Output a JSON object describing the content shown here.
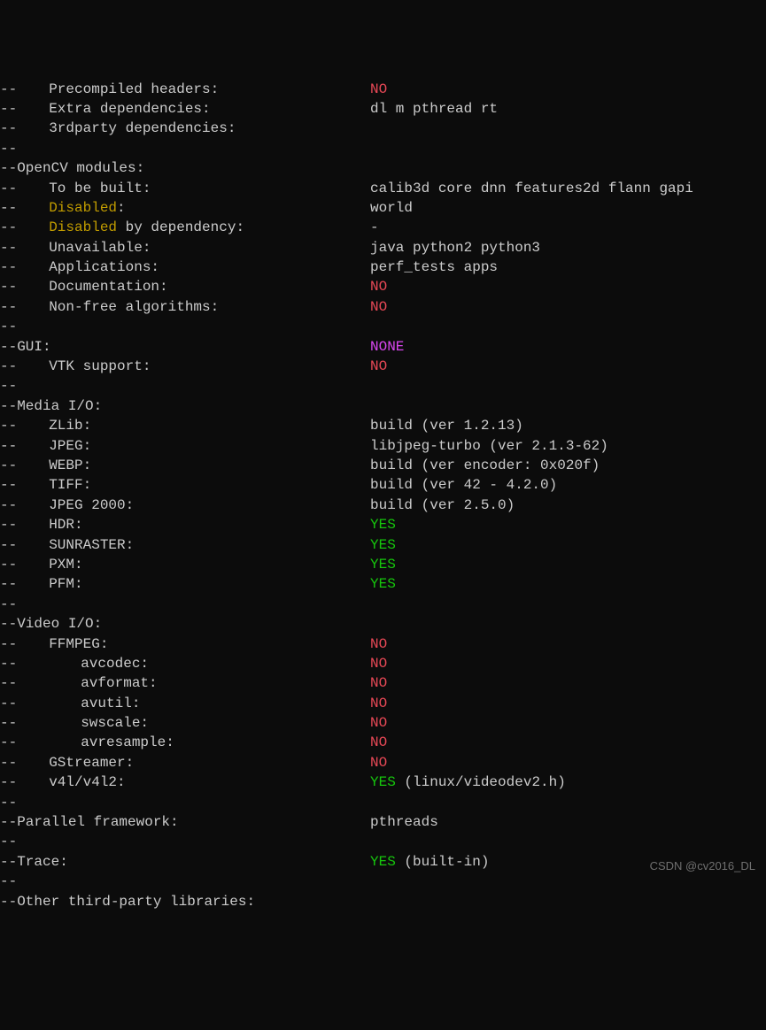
{
  "rows": [
    {
      "dash": "--",
      "indent": 1,
      "label": "Precompiled headers:",
      "value": "NO",
      "vclass": "c-red"
    },
    {
      "dash": "--",
      "indent": 1,
      "label": "Extra dependencies:",
      "value": "dl m pthread rt",
      "vclass": "c-white"
    },
    {
      "dash": "--",
      "indent": 1,
      "label": "3rdparty dependencies:",
      "value": "",
      "vclass": "c-white"
    },
    {
      "dash": "--",
      "indent": 0,
      "label": "",
      "value": "",
      "vclass": ""
    },
    {
      "dash": "--",
      "indent": 0,
      "label": "OpenCV modules:",
      "value": "",
      "vclass": ""
    },
    {
      "dash": "--",
      "indent": 1,
      "label": "To be built:",
      "value": "calib3d core dnn features2d flann gapi",
      "vclass": "c-white"
    },
    {
      "dash": "--",
      "indent": 1,
      "label_parts": [
        {
          "t": "Disabled",
          "c": "c-yellow"
        },
        {
          "t": ":",
          "c": "c-white"
        }
      ],
      "value": "world",
      "vclass": "c-white"
    },
    {
      "dash": "--",
      "indent": 1,
      "label_parts": [
        {
          "t": "Disabled",
          "c": "c-yellow"
        },
        {
          "t": " by dependency:",
          "c": "c-white"
        }
      ],
      "value": "-",
      "vclass": "c-white"
    },
    {
      "dash": "--",
      "indent": 1,
      "label": "Unavailable:",
      "value": "java python2 python3",
      "vclass": "c-white"
    },
    {
      "dash": "--",
      "indent": 1,
      "label": "Applications:",
      "value": "perf_tests apps",
      "vclass": "c-white"
    },
    {
      "dash": "--",
      "indent": 1,
      "label": "Documentation:",
      "value": "NO",
      "vclass": "c-red"
    },
    {
      "dash": "--",
      "indent": 1,
      "label": "Non-free algorithms:",
      "value": "NO",
      "vclass": "c-red"
    },
    {
      "dash": "--",
      "indent": 0,
      "label": "",
      "value": "",
      "vclass": ""
    },
    {
      "dash": "--",
      "indent": 0,
      "label": "GUI:",
      "value": "NONE",
      "vclass": "c-magenta"
    },
    {
      "dash": "--",
      "indent": 1,
      "label": "VTK support:",
      "value": "NO",
      "vclass": "c-red"
    },
    {
      "dash": "--",
      "indent": 0,
      "label": "",
      "value": "",
      "vclass": ""
    },
    {
      "dash": "--",
      "indent": 0,
      "label": "Media I/O:",
      "value": "",
      "vclass": ""
    },
    {
      "dash": "--",
      "indent": 1,
      "label": "ZLib:",
      "value": "build (ver 1.2.13)",
      "vclass": "c-white"
    },
    {
      "dash": "--",
      "indent": 1,
      "label": "JPEG:",
      "value": "libjpeg-turbo (ver 2.1.3-62)",
      "vclass": "c-white"
    },
    {
      "dash": "--",
      "indent": 1,
      "label": "WEBP:",
      "value": "build (ver encoder: 0x020f)",
      "vclass": "c-white"
    },
    {
      "dash": "--",
      "indent": 1,
      "label": "TIFF:",
      "value": "build (ver 42 - 4.2.0)",
      "vclass": "c-white"
    },
    {
      "dash": "--",
      "indent": 1,
      "label": "JPEG 2000:",
      "value": "build (ver 2.5.0)",
      "vclass": "c-white"
    },
    {
      "dash": "--",
      "indent": 1,
      "label": "HDR:",
      "value": "YES",
      "vclass": "c-green"
    },
    {
      "dash": "--",
      "indent": 1,
      "label": "SUNRASTER:",
      "value": "YES",
      "vclass": "c-green"
    },
    {
      "dash": "--",
      "indent": 1,
      "label": "PXM:",
      "value": "YES",
      "vclass": "c-green"
    },
    {
      "dash": "--",
      "indent": 1,
      "label": "PFM:",
      "value": "YES",
      "vclass": "c-green"
    },
    {
      "dash": "--",
      "indent": 0,
      "label": "",
      "value": "",
      "vclass": ""
    },
    {
      "dash": "--",
      "indent": 0,
      "label": "Video I/O:",
      "value": "",
      "vclass": ""
    },
    {
      "dash": "--",
      "indent": 1,
      "label": "FFMPEG:",
      "value": "NO",
      "vclass": "c-red"
    },
    {
      "dash": "--",
      "indent": 2,
      "label": "avcodec:",
      "value": "NO",
      "vclass": "c-red"
    },
    {
      "dash": "--",
      "indent": 2,
      "label": "avformat:",
      "value": "NO",
      "vclass": "c-red"
    },
    {
      "dash": "--",
      "indent": 2,
      "label": "avutil:",
      "value": "NO",
      "vclass": "c-red"
    },
    {
      "dash": "--",
      "indent": 2,
      "label": "swscale:",
      "value": "NO",
      "vclass": "c-red"
    },
    {
      "dash": "--",
      "indent": 2,
      "label": "avresample:",
      "value": "NO",
      "vclass": "c-red"
    },
    {
      "dash": "--",
      "indent": 1,
      "label": "GStreamer:",
      "value": "NO",
      "vclass": "c-red"
    },
    {
      "dash": "--",
      "indent": 1,
      "label": "v4l/v4l2:",
      "value_parts": [
        {
          "t": "YES",
          "c": "c-green"
        },
        {
          "t": " (linux/videodev2.h)",
          "c": "c-white"
        }
      ]
    },
    {
      "dash": "--",
      "indent": 0,
      "label": "",
      "value": "",
      "vclass": ""
    },
    {
      "dash": "--",
      "indent": 0,
      "label": "Parallel framework:",
      "value": "pthreads",
      "vclass": "c-white"
    },
    {
      "dash": "--",
      "indent": 0,
      "label": "",
      "value": "",
      "vclass": ""
    },
    {
      "dash": "--",
      "indent": 0,
      "label": "Trace:",
      "value_parts": [
        {
          "t": "YES",
          "c": "c-green"
        },
        {
          "t": " (built-in)",
          "c": "c-white"
        }
      ]
    },
    {
      "dash": "--",
      "indent": 0,
      "label": "",
      "value": "",
      "vclass": ""
    },
    {
      "dash": "--",
      "indent": 0,
      "label": "Other third-party libraries:",
      "value": "",
      "vclass": ""
    }
  ],
  "watermark": "CSDN @cv2016_DL"
}
